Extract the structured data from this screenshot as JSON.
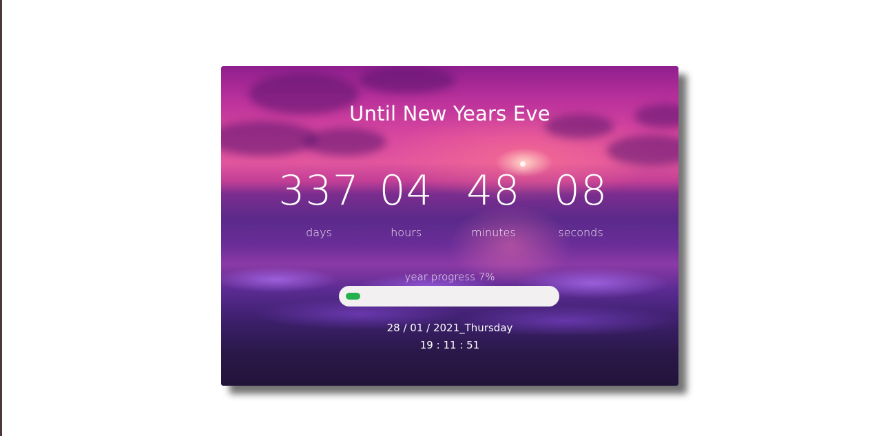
{
  "title": "Until New Years Eve",
  "countdown": {
    "days": {
      "value": "337",
      "label": "days"
    },
    "hours": {
      "value": "04",
      "label": "hours"
    },
    "minutes": {
      "value": "48",
      "label": "minutes"
    },
    "seconds": {
      "value": "08",
      "label": "seconds"
    }
  },
  "progress": {
    "label": "year progress 7%",
    "percent": 7,
    "color": "#22b14c"
  },
  "date": "28 / 01 / 2021_Thursday",
  "time": "19 : 11 : 51",
  "colors": {
    "card_top": "#8e1f8e",
    "card_bottom": "#22133a",
    "track": "#f2f0f0",
    "text": "#ffffff"
  }
}
